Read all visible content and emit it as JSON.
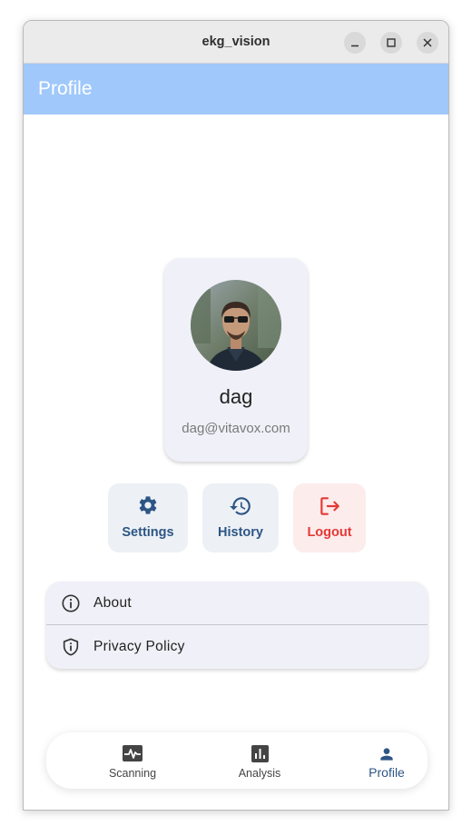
{
  "window": {
    "title": "ekg_vision"
  },
  "appbar": {
    "title": "Profile"
  },
  "profile": {
    "name": "dag",
    "email": "dag@vitavox.com"
  },
  "actions": [
    {
      "label": "Settings",
      "icon": "gear-icon"
    },
    {
      "label": "History",
      "icon": "history-icon"
    },
    {
      "label": "Logout",
      "icon": "logout-icon"
    }
  ],
  "info_items": [
    {
      "label": "About",
      "icon": "info-icon"
    },
    {
      "label": "Privacy Policy",
      "icon": "shield-icon"
    }
  ],
  "bottom_nav": {
    "items": [
      {
        "label": "Scanning",
        "icon": "heartbeat-icon"
      },
      {
        "label": "Analysis",
        "icon": "bar-chart-icon"
      },
      {
        "label": "Profile",
        "icon": "person-icon"
      }
    ],
    "selected": "Profile"
  },
  "colors": {
    "appbar": "#a0c8fb",
    "card": "#f0f0f8",
    "accent": "#2d5585",
    "danger": "#e53935"
  }
}
